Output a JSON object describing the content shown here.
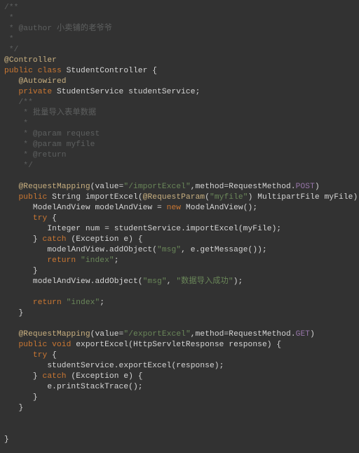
{
  "code": {
    "lines": [
      {
        "ind": 0,
        "spans": [
          {
            "c": "cm",
            "t": "/**"
          }
        ]
      },
      {
        "ind": 0,
        "spans": [
          {
            "c": "cm",
            "t": " *"
          }
        ]
      },
      {
        "ind": 0,
        "spans": [
          {
            "c": "cm",
            "t": " * @author 小卖铺的老爷爷"
          }
        ]
      },
      {
        "ind": 0,
        "spans": [
          {
            "c": "cm",
            "t": " *"
          }
        ]
      },
      {
        "ind": 0,
        "spans": [
          {
            "c": "cm",
            "t": " */"
          }
        ]
      },
      {
        "ind": 0,
        "spans": [
          {
            "c": "an",
            "t": "@Controller"
          }
        ]
      },
      {
        "ind": 0,
        "spans": [
          {
            "c": "kw",
            "t": "public class "
          },
          {
            "c": "ty",
            "t": "StudentController {"
          }
        ]
      },
      {
        "ind": 1,
        "spans": [
          {
            "c": "an",
            "t": "@Autowired"
          }
        ]
      },
      {
        "ind": 1,
        "spans": [
          {
            "c": "kw",
            "t": "private "
          },
          {
            "c": "ty",
            "t": "StudentService studentService;"
          }
        ]
      },
      {
        "ind": 1,
        "spans": [
          {
            "c": "cm",
            "t": "/**"
          }
        ]
      },
      {
        "ind": 1,
        "spans": [
          {
            "c": "cm",
            "t": " * 批量导入表单数据"
          }
        ]
      },
      {
        "ind": 1,
        "spans": [
          {
            "c": "cm",
            "t": " *"
          }
        ]
      },
      {
        "ind": 1,
        "spans": [
          {
            "c": "cm",
            "t": " * @param request"
          }
        ]
      },
      {
        "ind": 1,
        "spans": [
          {
            "c": "cm",
            "t": " * @param myfile"
          }
        ]
      },
      {
        "ind": 1,
        "spans": [
          {
            "c": "cm",
            "t": " * @return"
          }
        ]
      },
      {
        "ind": 1,
        "spans": [
          {
            "c": "cm",
            "t": " */"
          }
        ]
      },
      {
        "ind": 0,
        "spans": [
          {
            "c": "pl",
            "t": " "
          }
        ]
      },
      {
        "ind": 1,
        "spans": [
          {
            "c": "an",
            "t": "@RequestMapping"
          },
          {
            "c": "pl",
            "t": "(value="
          },
          {
            "c": "st",
            "t": "\"/importExcel\""
          },
          {
            "c": "pl",
            "t": ",method=RequestMethod."
          },
          {
            "c": "cn",
            "t": "POST"
          },
          {
            "c": "pl",
            "t": ")"
          }
        ]
      },
      {
        "ind": 1,
        "spans": [
          {
            "c": "kw",
            "t": "public "
          },
          {
            "c": "ty",
            "t": "String "
          },
          {
            "c": "fn",
            "t": "importExcel"
          },
          {
            "c": "pl",
            "t": "("
          },
          {
            "c": "an",
            "t": "@RequestParam"
          },
          {
            "c": "pl",
            "t": "("
          },
          {
            "c": "st",
            "t": "\"myfile\""
          },
          {
            "c": "pl",
            "t": ") MultipartFile myFile) {"
          }
        ]
      },
      {
        "ind": 2,
        "spans": [
          {
            "c": "ty",
            "t": "ModelAndView modelAndView = "
          },
          {
            "c": "kw",
            "t": "new "
          },
          {
            "c": "ty",
            "t": "ModelAndView();"
          }
        ]
      },
      {
        "ind": 2,
        "spans": [
          {
            "c": "kw",
            "t": "try "
          },
          {
            "c": "pl",
            "t": "{"
          }
        ]
      },
      {
        "ind": 3,
        "spans": [
          {
            "c": "ty",
            "t": "Integer num = studentService.importExcel(myFile);"
          }
        ]
      },
      {
        "ind": 2,
        "spans": [
          {
            "c": "pl",
            "t": "} "
          },
          {
            "c": "kw",
            "t": "catch "
          },
          {
            "c": "pl",
            "t": "(Exception e) {"
          }
        ]
      },
      {
        "ind": 3,
        "spans": [
          {
            "c": "ty",
            "t": "modelAndView.addObject("
          },
          {
            "c": "st",
            "t": "\"msg\""
          },
          {
            "c": "pl",
            "t": ", e.getMessage());"
          }
        ]
      },
      {
        "ind": 3,
        "spans": [
          {
            "c": "kw",
            "t": "return "
          },
          {
            "c": "st",
            "t": "\"index\""
          },
          {
            "c": "pl",
            "t": ";"
          }
        ]
      },
      {
        "ind": 2,
        "spans": [
          {
            "c": "pl",
            "t": "}"
          }
        ]
      },
      {
        "ind": 2,
        "spans": [
          {
            "c": "ty",
            "t": "modelAndView.addObject("
          },
          {
            "c": "st",
            "t": "\"msg\""
          },
          {
            "c": "pl",
            "t": ", "
          },
          {
            "c": "st",
            "t": "\"数据导入成功\""
          },
          {
            "c": "pl",
            "t": ");"
          }
        ]
      },
      {
        "ind": 0,
        "spans": [
          {
            "c": "pl",
            "t": " "
          }
        ]
      },
      {
        "ind": 2,
        "spans": [
          {
            "c": "kw",
            "t": "return "
          },
          {
            "c": "st",
            "t": "\"index\""
          },
          {
            "c": "pl",
            "t": ";"
          }
        ]
      },
      {
        "ind": 1,
        "spans": [
          {
            "c": "pl",
            "t": "}"
          }
        ]
      },
      {
        "ind": 0,
        "spans": [
          {
            "c": "pl",
            "t": " "
          }
        ]
      },
      {
        "ind": 1,
        "spans": [
          {
            "c": "an",
            "t": "@RequestMapping"
          },
          {
            "c": "pl",
            "t": "(value="
          },
          {
            "c": "st",
            "t": "\"/exportExcel\""
          },
          {
            "c": "pl",
            "t": ",method=RequestMethod."
          },
          {
            "c": "cn",
            "t": "GET"
          },
          {
            "c": "pl",
            "t": ")"
          }
        ]
      },
      {
        "ind": 1,
        "spans": [
          {
            "c": "kw",
            "t": "public void "
          },
          {
            "c": "fn",
            "t": "exportExcel"
          },
          {
            "c": "pl",
            "t": "(HttpServletResponse response) {"
          }
        ]
      },
      {
        "ind": 2,
        "spans": [
          {
            "c": "kw",
            "t": "try "
          },
          {
            "c": "pl",
            "t": "{"
          }
        ]
      },
      {
        "ind": 3,
        "spans": [
          {
            "c": "ty",
            "t": "studentService.exportExcel(response);"
          }
        ]
      },
      {
        "ind": 2,
        "spans": [
          {
            "c": "pl",
            "t": "} "
          },
          {
            "c": "kw",
            "t": "catch "
          },
          {
            "c": "pl",
            "t": "(Exception e) {"
          }
        ]
      },
      {
        "ind": 3,
        "spans": [
          {
            "c": "ty",
            "t": "e.printStackTrace();"
          }
        ]
      },
      {
        "ind": 2,
        "spans": [
          {
            "c": "pl",
            "t": "}"
          }
        ]
      },
      {
        "ind": 1,
        "spans": [
          {
            "c": "pl",
            "t": "}"
          }
        ]
      },
      {
        "ind": 0,
        "spans": [
          {
            "c": "pl",
            "t": " "
          }
        ]
      },
      {
        "ind": 0,
        "spans": [
          {
            "c": "pl",
            "t": " "
          }
        ]
      },
      {
        "ind": 0,
        "spans": [
          {
            "c": "pl",
            "t": "}"
          }
        ]
      }
    ],
    "indent_unit": "   "
  }
}
